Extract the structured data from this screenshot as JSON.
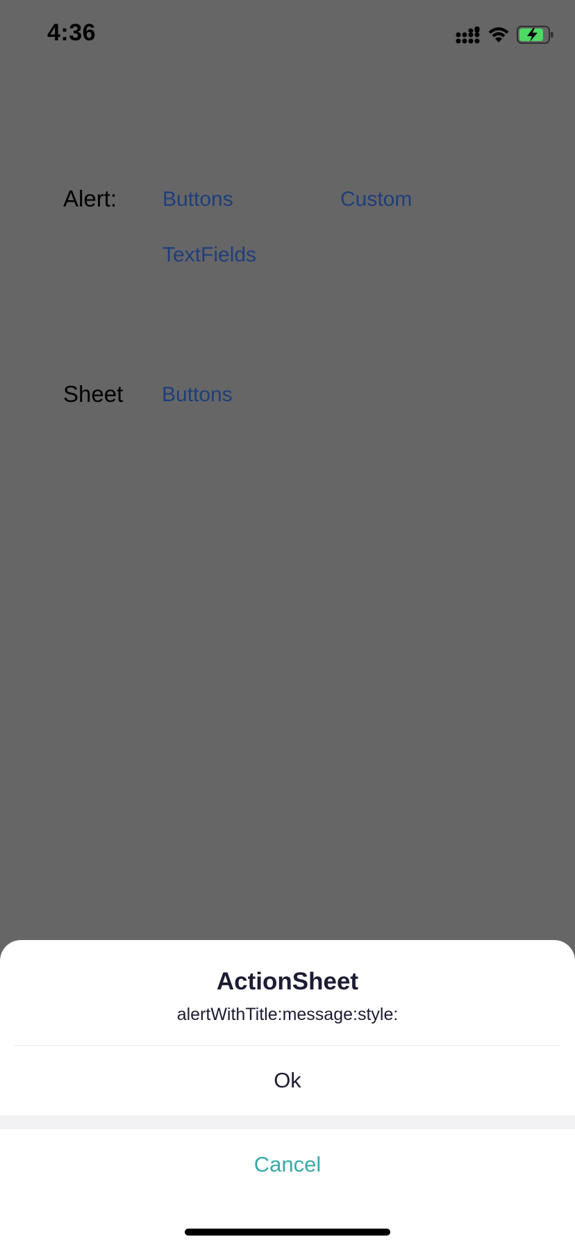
{
  "status_bar": {
    "time": "4:36",
    "icons": [
      "cellular-signal-icon",
      "wifi-icon",
      "battery-charging-icon"
    ],
    "battery_color": "#4cd964"
  },
  "main": {
    "alert_label": "Alert:",
    "alert_buttons_label": "Buttons",
    "alert_custom_label": "Custom",
    "alert_textfields_label": "TextFields",
    "sheet_label": "Sheet",
    "sheet_buttons_label": "Buttons"
  },
  "action_sheet": {
    "title": "ActionSheet",
    "message": "alertWithTitle:message:style:",
    "ok_label": "Ok",
    "cancel_label": "Cancel"
  },
  "colors": {
    "overlay": "#666666",
    "link": "#1f3e7a",
    "cancel": "#3aa9a9"
  }
}
